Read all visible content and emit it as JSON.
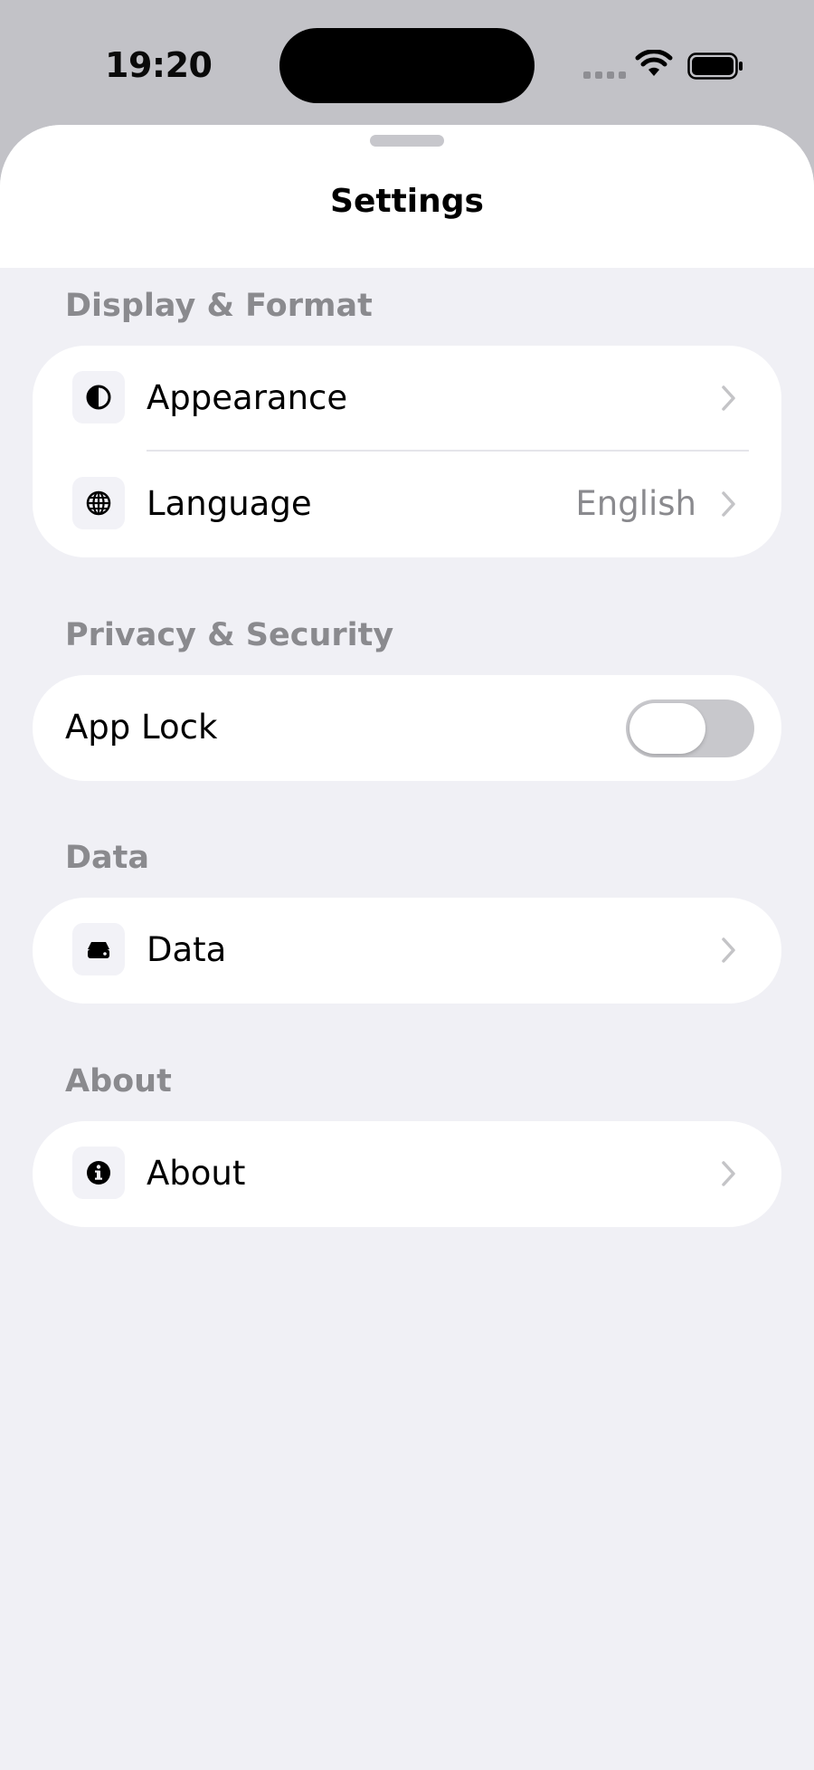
{
  "status_bar": {
    "time": "19:20"
  },
  "sheet": {
    "title": "Settings"
  },
  "sections": [
    {
      "header": "Display & Format",
      "rows": [
        {
          "label": "Appearance",
          "icon": "appearance-icon",
          "value": ""
        },
        {
          "label": "Language",
          "icon": "globe-icon",
          "value": "English"
        }
      ]
    },
    {
      "header": "Privacy & Security",
      "rows": [
        {
          "label": "App Lock",
          "toggle_on": false
        }
      ]
    },
    {
      "header": "Data",
      "rows": [
        {
          "label": "Data",
          "icon": "storage-icon"
        }
      ]
    },
    {
      "header": "About",
      "rows": [
        {
          "label": "About",
          "icon": "info-icon"
        }
      ]
    }
  ],
  "colors": {
    "background": "#f0f0f5",
    "card": "#ffffff",
    "secondary_text": "#8a8a8e",
    "toggle_off": "#c8c8cc"
  }
}
